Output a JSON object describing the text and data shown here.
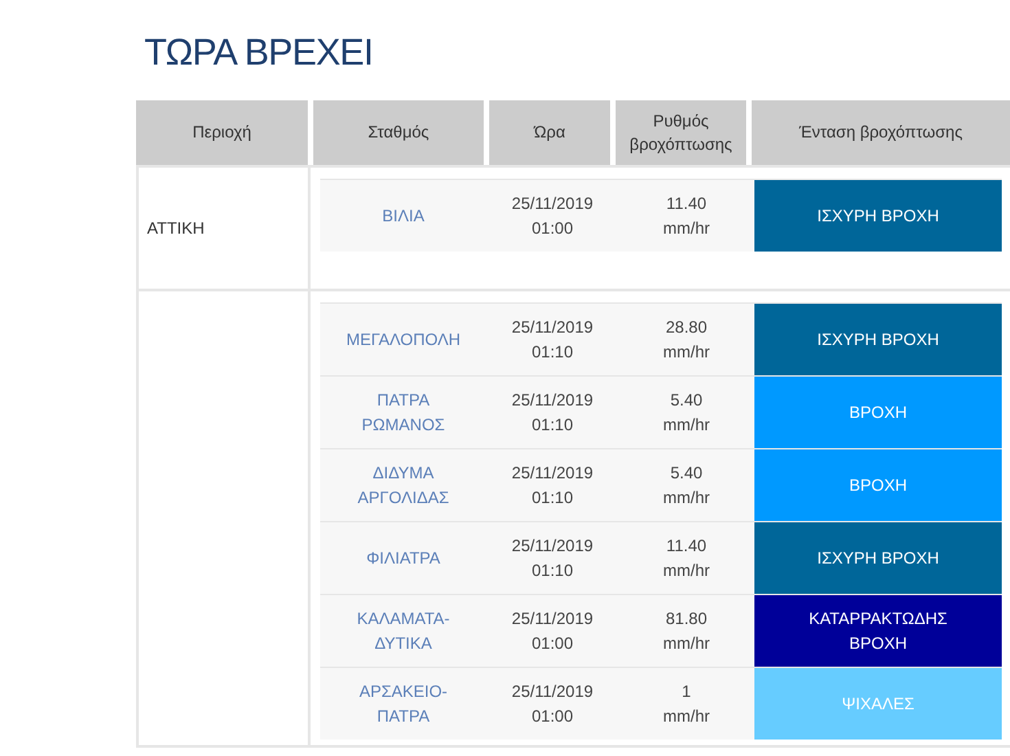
{
  "title": "ΤΩΡΑ ΒΡΕΧΕΙ",
  "columns": [
    "Περιοχή",
    "Σταθμός",
    "Ώρα",
    "Ρυθμός βροχόπτωσης",
    "Ένταση βροχόπτωσης"
  ],
  "groups": [
    {
      "region": "ΑΤΤΙΚΗ",
      "rows": [
        {
          "station": "ΒΙΛΙΑ",
          "time": [
            "25/11/2019",
            "01:00"
          ],
          "rate": [
            "11.40",
            "mm/hr"
          ],
          "intensity": [
            "ΙΣΧΥΡΗ ΒΡΟΧΗ"
          ],
          "color": "#006699"
        }
      ]
    },
    {
      "rows": [
        {
          "station": "ΜΕΓΑΛΟΠΟΛΗ",
          "time": [
            "25/11/2019",
            "01:10"
          ],
          "rate": [
            "28.80",
            "mm/hr"
          ],
          "intensity": [
            "ΙΣΧΥΡΗ ΒΡΟΧΗ"
          ],
          "color": "#006699"
        },
        {
          "station": "ΠΑΤΡΑ ΡΩΜΑΝΟΣ",
          "time": [
            "25/11/2019",
            "01:10"
          ],
          "rate": [
            "5.40",
            "mm/hr"
          ],
          "intensity": [
            "ΒΡΟΧΗ"
          ],
          "color": "#0099ff"
        },
        {
          "station": "ΔΙΔΥΜΑ ΑΡΓΟΛΙΔΑΣ",
          "time": [
            "25/11/2019",
            "01:10"
          ],
          "rate": [
            "5.40",
            "mm/hr"
          ],
          "intensity": [
            "ΒΡΟΧΗ"
          ],
          "color": "#0099ff"
        },
        {
          "station": "ΦΙΛΙΑΤΡΑ",
          "time": [
            "25/11/2019",
            "01:10"
          ],
          "rate": [
            "11.40",
            "mm/hr"
          ],
          "intensity": [
            "ΙΣΧΥΡΗ ΒΡΟΧΗ"
          ],
          "color": "#006699"
        },
        {
          "station": "ΚΑΛΑΜΑΤΑ-ΔΥΤΙΚΑ",
          "time": [
            "25/11/2019",
            "01:00"
          ],
          "rate": [
            "81.80",
            "mm/hr"
          ],
          "intensity": [
            "ΚΑΤΑΡΡΑΚΤΩΔΗΣ",
            "ΒΡΟΧΗ"
          ],
          "color": "#000099"
        },
        {
          "station": "ΑΡΣΑΚΕΙΟ-ΠΑΤΡΑ",
          "time": [
            "25/11/2019",
            "01:00"
          ],
          "rate": [
            "1",
            "mm/hr"
          ],
          "intensity": [
            "ΨΙΧΑΛΕΣ"
          ],
          "color": "#66ccff"
        }
      ]
    }
  ]
}
